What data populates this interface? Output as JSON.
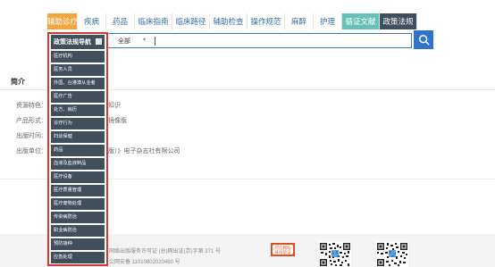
{
  "nav": {
    "tabs": [
      {
        "label": "辅助诊疗",
        "style": "active",
        "w": "w-fuzhu"
      },
      {
        "label": "疾病",
        "style": "",
        "w": "w-2"
      },
      {
        "label": "药品",
        "style": "",
        "w": "w-2"
      },
      {
        "label": "临床指南",
        "style": "",
        "w": "w-4"
      },
      {
        "label": "临床路径",
        "style": "",
        "w": "w-4"
      },
      {
        "label": "辅助检查",
        "style": "",
        "w": "w-4"
      },
      {
        "label": "操作规范",
        "style": "",
        "w": "w-4"
      },
      {
        "label": "麻醉",
        "style": "",
        "w": "w-2"
      },
      {
        "label": "护理",
        "style": "",
        "w": "w-2"
      },
      {
        "label": "循证文献",
        "style": "teal",
        "w": "w-4"
      },
      {
        "label": "政策法规",
        "style": "dark",
        "w": "w-4"
      }
    ]
  },
  "search": {
    "selected": "全部",
    "caret": "▾"
  },
  "intro": {
    "title": "简介",
    "rows": [
      {
        "label": "资源特色：",
        "value": "知识"
      },
      {
        "label": "产品形式：",
        "value": "镜像版"
      },
      {
        "label": "出版时间：",
        "value": ""
      },
      {
        "label": "出版单位：",
        "value": "版）》电子杂志社有限公司"
      }
    ]
  },
  "footer": {
    "license": "网络出版服务许可证 (总)网出证(京)字第 271 号",
    "icp": "公网安备 11010802020460 号",
    "badge_text": "可信网站",
    "badge_sub": "身份验证"
  },
  "panel": {
    "title": "政策法规导航",
    "items": [
      "医疗机构",
      "医务人员",
      "外国、台港澳从业者",
      "医疗广告",
      "处方、病历",
      "诊疗行为",
      "妇幼保健",
      "药品",
      "血液及血液制品",
      "医疗设备",
      "医疗质量管理",
      "医疗废物处理",
      "传染病防治",
      "职业病防治",
      "预防接种",
      "应急处理"
    ]
  },
  "colors": {
    "accent": "#f3a63f",
    "primary": "#2f74c8",
    "panel_border": "#d9372f",
    "panel_bg": "#3f4f5c",
    "teal": "#66c2b9"
  }
}
